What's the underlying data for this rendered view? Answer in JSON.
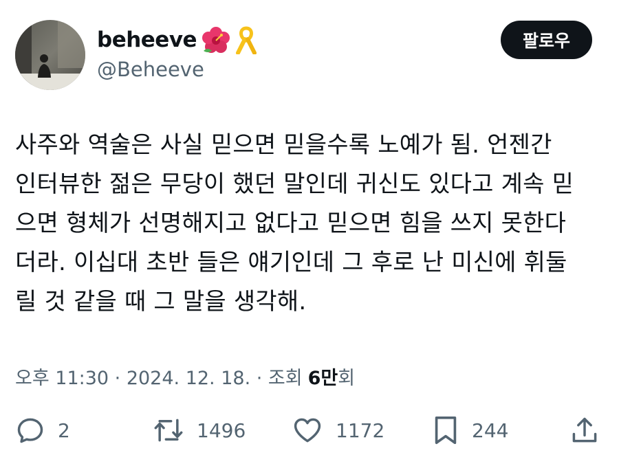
{
  "author": {
    "display_name": "beheeve",
    "badges": [
      "hibiscus-emoji",
      "yellow-ribbon-emoji"
    ],
    "handle": "@Beheeve"
  },
  "follow_label": "팔로우",
  "tweet": {
    "lines": [
      "사주와 역술은 사실 믿으면 믿을수록 노예가 됨. 언젠간",
      "인터뷰한 젊은 무당이 했던 말인데 귀신도 있다고 계속 믿",
      "으면 형체가 선명해지고 없다고 믿으면 힘을 쓰지 못한다",
      "더라. 이십대 초반 들은 얘기인데 그 후로 난 미신에 휘둘",
      "릴 것 같을 때 그 말을 생각해."
    ]
  },
  "meta": {
    "time_date": "오후 11:30 · 2024. 12. 18. · 조회",
    "views_count": "6만",
    "views_suffix": "회"
  },
  "actions": {
    "reply": {
      "icon": "reply-icon",
      "count": "2"
    },
    "repost": {
      "icon": "repost-icon",
      "count": "1496"
    },
    "like": {
      "icon": "heart-icon",
      "count": "1172"
    },
    "bookmark": {
      "icon": "bookmark-icon",
      "count": "244"
    },
    "share": {
      "icon": "share-icon"
    }
  },
  "colors": {
    "text_primary": "#0f1419",
    "text_secondary": "#536471",
    "button_bg": "#0f1419",
    "button_text": "#ffffff"
  }
}
